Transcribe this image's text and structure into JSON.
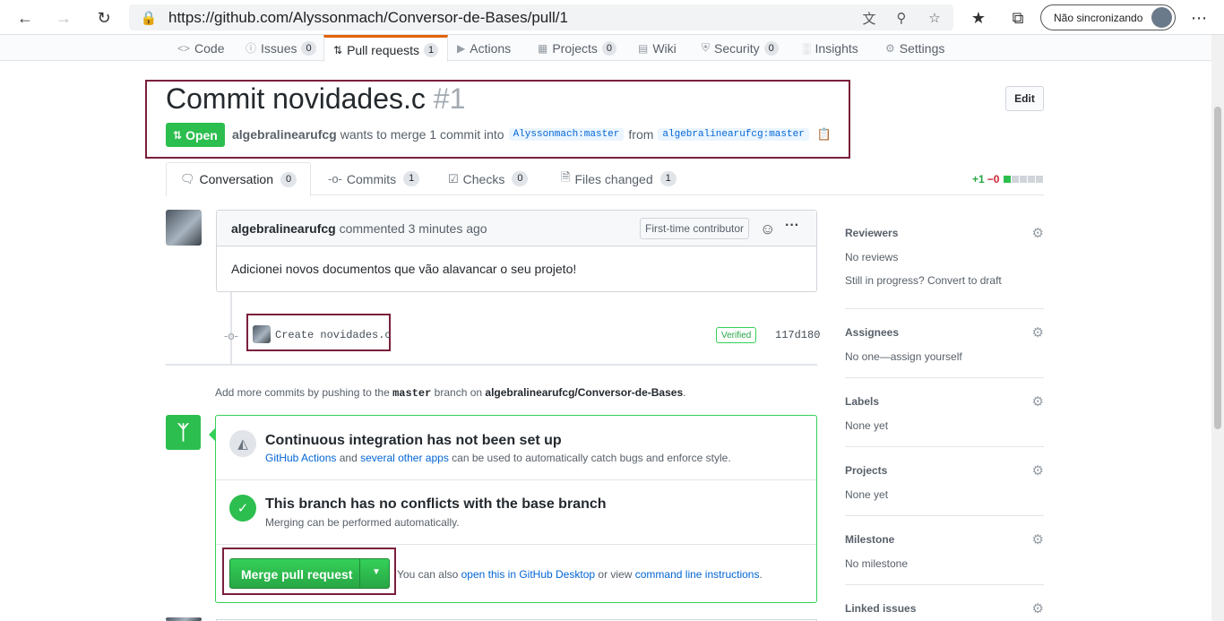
{
  "browser": {
    "url": "https://github.com/Alyssonmach/Conversor-de-Bases/pull/1",
    "profile_label": "Não sincronizando"
  },
  "repo_nav": {
    "code": "Code",
    "issues": "Issues",
    "issues_count": "0",
    "pulls": "Pull requests",
    "pulls_count": "1",
    "actions": "Actions",
    "projects": "Projects",
    "projects_count": "0",
    "wiki": "Wiki",
    "security": "Security",
    "security_count": "0",
    "insights": "Insights",
    "settings": "Settings"
  },
  "pr": {
    "title": "Commit novidades.c",
    "number": "#1",
    "state": "Open",
    "author": "algebralinearufcg",
    "meta_text": "wants to merge 1 commit into",
    "base_branch": "Alyssonmach:master",
    "from_text": "from",
    "head_branch": "algebralinearufcg:master",
    "edit_label": "Edit"
  },
  "tabs": {
    "conversation": "Conversation",
    "conversation_count": "0",
    "commits": "Commits",
    "commits_count": "1",
    "checks": "Checks",
    "checks_count": "0",
    "files": "Files changed",
    "files_count": "1"
  },
  "diffstat": {
    "additions": "+1",
    "deletions": "−0"
  },
  "comment": {
    "author": "algebralinearufcg",
    "action": "commented 3 minutes ago",
    "label": "First-time contributor",
    "body": "Adicionei novos documentos que vão alavancar o seu projeto!"
  },
  "commit": {
    "message": "Create novidades.c",
    "verified": "Verified",
    "sha": "117d180"
  },
  "hint": {
    "prefix": "Add more commits by pushing to the",
    "branch": "master",
    "middle": "branch on",
    "repo": "algebralinearufcg/Conversor-de-Bases",
    "suffix": "."
  },
  "merge": {
    "ci_title": "Continuous integration has not been set up",
    "ci_link1": "GitHub Actions",
    "ci_and": "and",
    "ci_link2": "several other apps",
    "ci_rest": "can be used to automatically catch bugs and enforce style.",
    "conflict_title": "This branch has no conflicts with the base branch",
    "conflict_sub": "Merging can be performed automatically.",
    "button_label": "Merge pull request",
    "also_text": "You can also",
    "desktop_link": "open this in GitHub Desktop",
    "or_text": "or view",
    "cli_link": "command line instructions",
    "period": "."
  },
  "sidebar": {
    "reviewers_title": "Reviewers",
    "reviewers_value": "No reviews",
    "reviewers_extra": "Still in progress? Convert to draft",
    "assignees_title": "Assignees",
    "assignees_value": "No one—assign yourself",
    "labels_title": "Labels",
    "labels_value": "None yet",
    "projects_title": "Projects",
    "projects_value": "None yet",
    "milestone_title": "Milestone",
    "milestone_value": "No milestone",
    "linked_title": "Linked issues"
  },
  "colors": {
    "open_green": "#2cbe4e",
    "annotation_red": "#7a1f3a",
    "link_blue": "#0366d6"
  }
}
